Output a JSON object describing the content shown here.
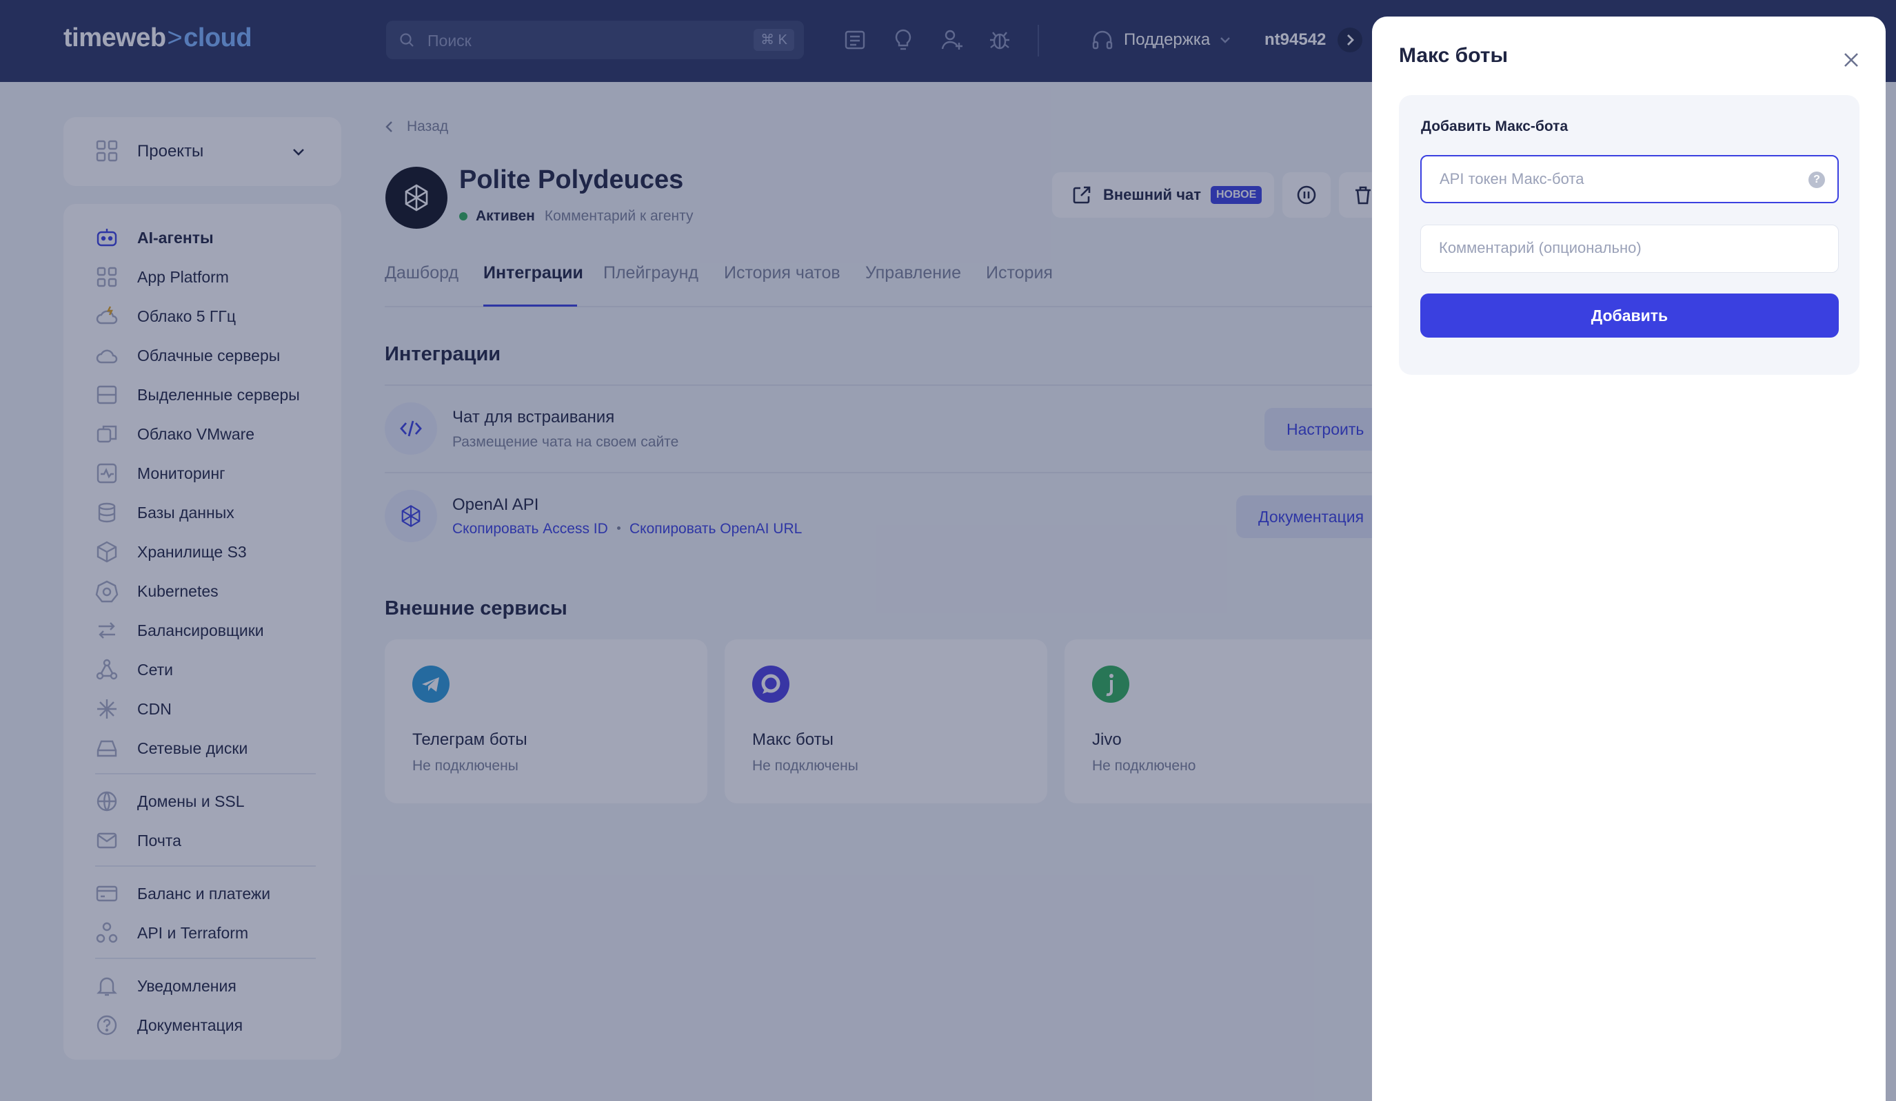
{
  "header": {
    "logo_main": "timeweb",
    "logo_sep": ">",
    "logo_cloud": "cloud",
    "search_placeholder": "Поиск",
    "search_shortcut": "⌘ K",
    "support_label": "Поддержка",
    "username": "nt94542"
  },
  "sidebar": {
    "projects_label": "Проекты",
    "items": [
      {
        "label": "AI-агенты",
        "icon": "robot-icon",
        "active": true
      },
      {
        "label": "App Platform",
        "icon": "apps-grid-icon"
      },
      {
        "label": "Облако 5 ГГц",
        "icon": "cloud-lightning-icon"
      },
      {
        "label": "Облачные серверы",
        "icon": "cloud-icon"
      },
      {
        "label": "Выделенные серверы",
        "icon": "server-icon"
      },
      {
        "label": "Облако VMware",
        "icon": "vmware-icon"
      },
      {
        "label": "Мониторинг",
        "icon": "monitoring-icon"
      },
      {
        "label": "Базы данных",
        "icon": "database-icon"
      },
      {
        "label": "Хранилище S3",
        "icon": "storage-box-icon"
      },
      {
        "label": "Kubernetes",
        "icon": "kubernetes-icon"
      },
      {
        "label": "Балансировщики",
        "icon": "balancer-arrows-icon"
      },
      {
        "label": "Сети",
        "icon": "network-icon"
      },
      {
        "label": "CDN",
        "icon": "cdn-icon"
      },
      {
        "label": "Сетевые диски",
        "icon": "disk-icon"
      },
      {
        "label": "Домены и SSL",
        "icon": "globe-icon"
      },
      {
        "label": "Почта",
        "icon": "mail-icon"
      },
      {
        "label": "Баланс и платежи",
        "icon": "card-icon"
      },
      {
        "label": "API и Terraform",
        "icon": "api-icon"
      },
      {
        "label": "Уведомления",
        "icon": "bell-icon"
      },
      {
        "label": "Документация",
        "icon": "help-circle-icon"
      }
    ]
  },
  "main": {
    "back_label": "Назад",
    "agent_name": "Polite Polydeuces",
    "agent_status": "Активен",
    "agent_comment": "Комментарий к агенту",
    "ext_chat_label": "Внешний чат",
    "ext_chat_badge": "НОВОЕ",
    "tabs": [
      "Дашборд",
      "Интеграции",
      "Плейграунд",
      "История чатов",
      "Управление",
      "История"
    ],
    "active_tab": "Интеграции",
    "integrations_title": "Интеграции",
    "integrations": [
      {
        "title": "Чат для встраивания",
        "subtitle": "Размещение чата на своем сайте",
        "button": "Настроить"
      },
      {
        "title": "OpenAI API",
        "link1": "Скопировать Access ID",
        "link2": "Скопировать OpenAI URL",
        "button": "Документация"
      }
    ],
    "external_title": "Внешние сервисы",
    "services": [
      {
        "title": "Телеграм боты",
        "status": "Не подключены",
        "color": "#2a9ad8"
      },
      {
        "title": "Макс боты",
        "status": "Не подключены",
        "color": "#4b3fe0"
      },
      {
        "title": "Jivo",
        "status": "Не подключено",
        "color": "#2fae5b"
      }
    ]
  },
  "drawer": {
    "title": "Макс боты",
    "card_title": "Добавить Макс-бота",
    "token_placeholder": "API токен Макс-бота",
    "comment_placeholder": "Комментарий (опционально)",
    "submit_label": "Добавить"
  },
  "colors": {
    "header_bg": "#2a3563",
    "accent": "#3a40e0",
    "active_green": "#2fae5b"
  }
}
